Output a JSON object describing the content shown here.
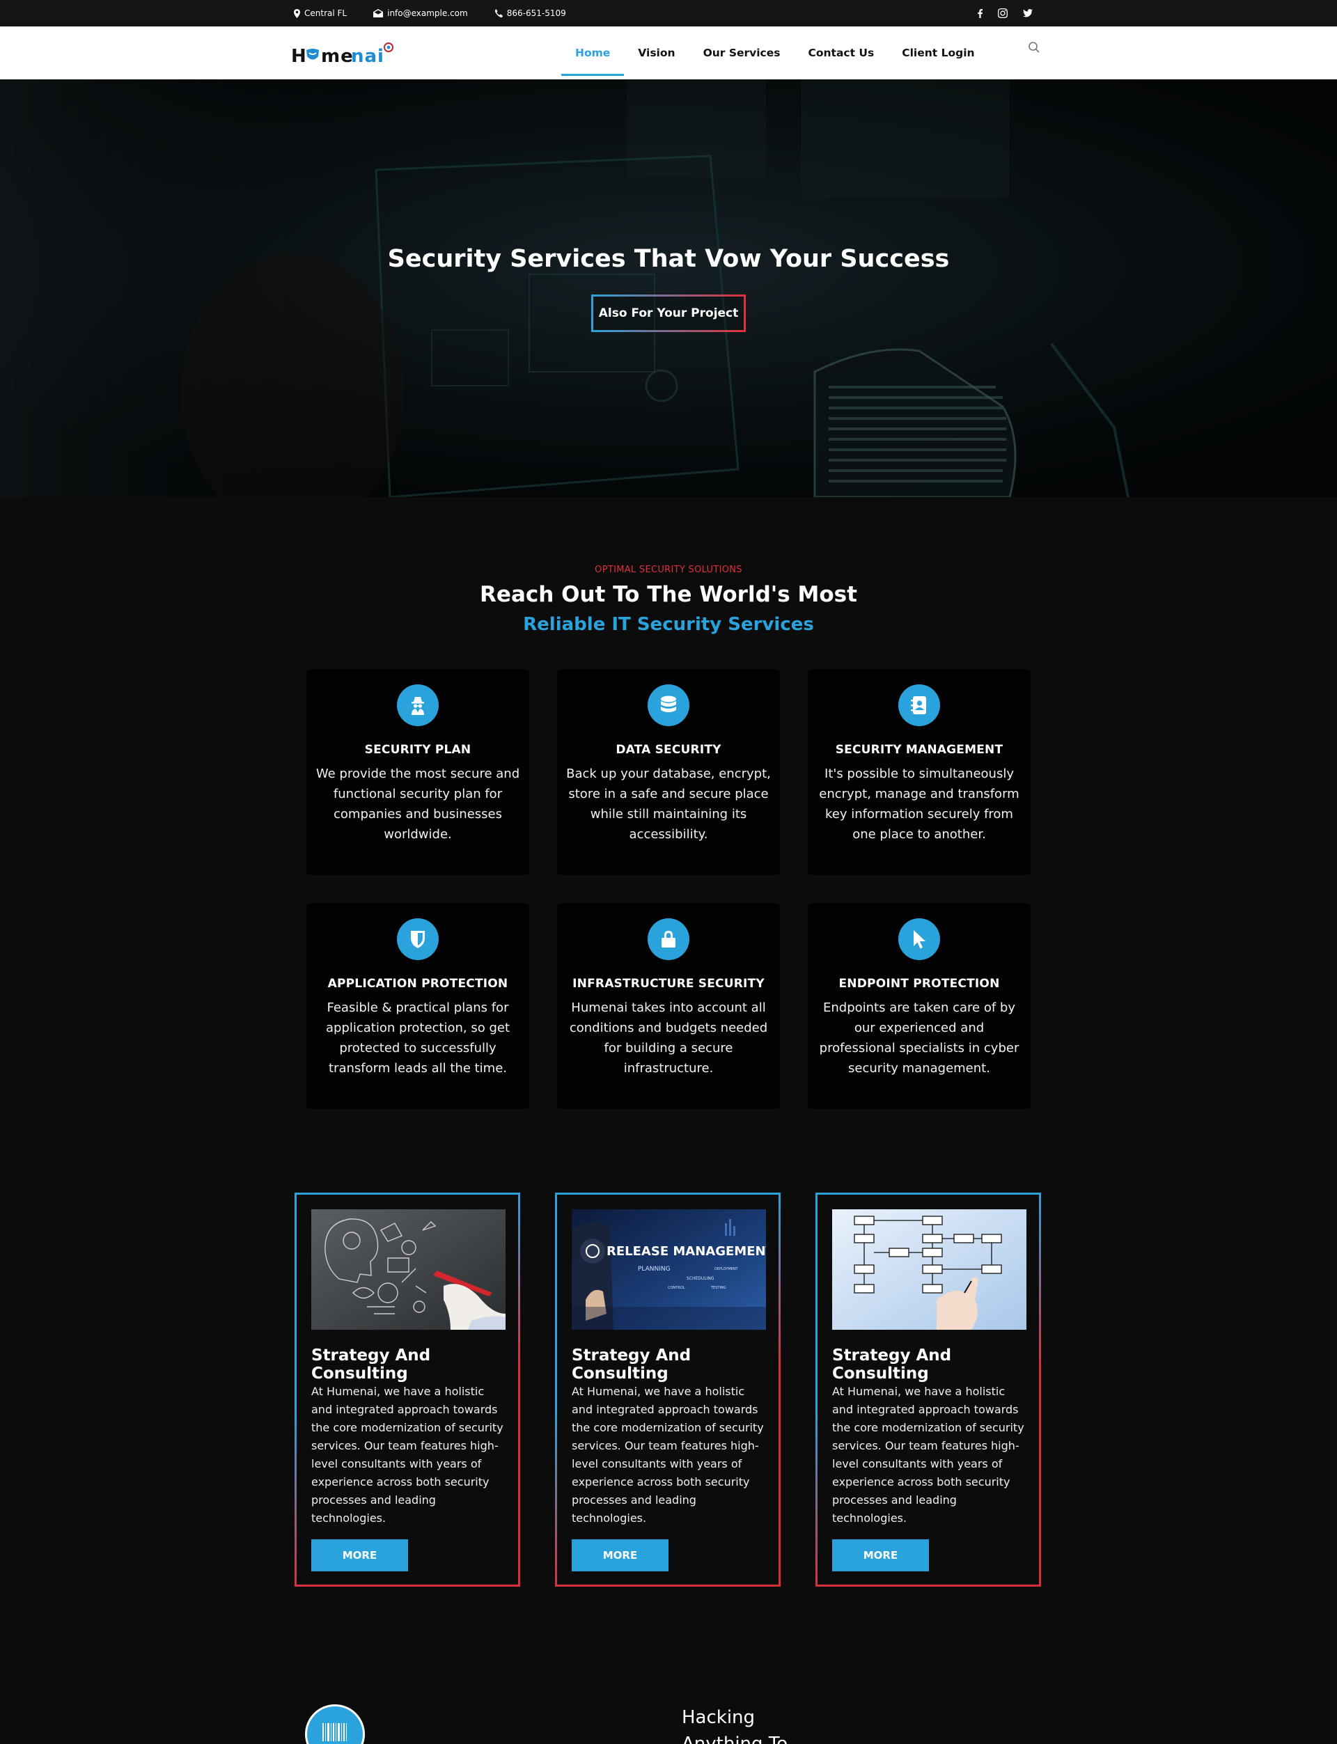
{
  "topbar": {
    "location": "Central FL",
    "email": "info@example.com",
    "phone": "866-651-5109",
    "social": [
      "facebook-icon",
      "instagram-icon",
      "twitter-icon"
    ]
  },
  "nav": {
    "logo_text": "Humenai",
    "links": [
      "Home",
      "Vision",
      "Our Services",
      "Contact Us",
      "Client Login"
    ],
    "active": "Home"
  },
  "hero": {
    "title": "Security Services That Vow Your Success",
    "button": "Also For Your Project"
  },
  "services": {
    "eyebrow": "OPTIMAL SECURITY SOLUTIONS",
    "title": "Reach Out To The World's Most",
    "subtitle": "Reliable IT Security Services",
    "items": [
      {
        "icon": "spy-icon",
        "title": "SECURITY PLAN",
        "text": "We provide the most secure and functional security plan for companies and businesses worldwide."
      },
      {
        "icon": "database-icon",
        "title": "DATA SECURITY",
        "text": "Back up your database, encrypt, store in a safe and secure place while still maintaining its accessibility."
      },
      {
        "icon": "address-book-icon",
        "title": "SECURITY MANAGEMENT",
        "text": "It's possible to simultaneously encrypt, manage and transform key information securely from one place to another."
      },
      {
        "icon": "shield-icon",
        "title": "APPLICATION PROTECTION",
        "text": "Feasible & practical plans for application protection, so get protected to successfully transform leads all the time."
      },
      {
        "icon": "lock-icon",
        "title": "INFRASTRUCTURE SECURITY",
        "text": "Humenai takes into account all conditions and budgets needed for building a secure infrastructure."
      },
      {
        "icon": "cursor-icon",
        "title": "ENDPOINT PROTECTION",
        "text": "Endpoints are taken care of by our experienced and professional specialists in cyber security management."
      }
    ]
  },
  "cards": [
    {
      "title": "Strategy And Consulting",
      "text": "At Humenai, we have a holistic and integrated approach towards the core modernization of security services. Our team features high-level consultants with years of experience across both security processes and leading technologies.",
      "button": "MORE"
    },
    {
      "title": "Strategy And Consulting",
      "text": "At Humenai, we have a holistic and integrated approach towards the core modernization of security services. Our team features high-level consultants with years of experience across both security processes and leading technologies.",
      "button": "MORE",
      "image_text": "RELEASE MANAGEMENT",
      "image_sub": [
        "PLANNING",
        "DEPLOYMENT",
        "SCHEDULING",
        "CONTROL",
        "TESTING"
      ]
    },
    {
      "title": "Strategy And Consulting",
      "text": "At Humenai, we have a holistic and integrated approach towards the core modernization of security services. Our team features high-level consultants with years of experience across both security processes and leading technologies.",
      "button": "MORE"
    }
  ],
  "next_section": {
    "title_line1": "Hacking",
    "title_line2": "Anything To"
  },
  "colors": {
    "accent": "#2aa3dd",
    "red": "#e0303a",
    "bg": "#0c0c0c"
  }
}
